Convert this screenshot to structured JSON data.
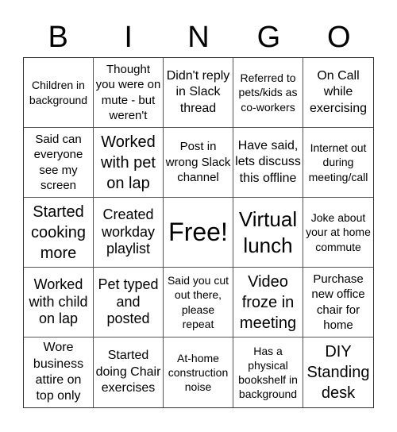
{
  "header": {
    "letters": [
      "B",
      "I",
      "N",
      "G",
      "O"
    ]
  },
  "board": {
    "cells": [
      "Children in background",
      "Thought you were on mute - but weren't",
      "Didn't reply in Slack thread",
      "Referred to pets/kids as co-workers",
      "On Call while exercising",
      "Said can everyone see my screen",
      "Worked with pet on lap",
      "Post in wrong Slack channel",
      "Have said, lets discuss this offline",
      "Internet out during meeting/call",
      "Started cooking more",
      "Created workday playlist",
      "Free!",
      "Virtual lunch",
      "Joke about your at home commute",
      "Worked with child on lap",
      "Pet typed and posted",
      "Said you cut out there, please repeat",
      "Video froze in meeting",
      "Purchase new office chair for home",
      "Wore business attire on top only",
      "Started doing Chair exercises",
      "At-home construction noise",
      "Has a physical bookshelf in background",
      "DIY Standing desk"
    ]
  }
}
